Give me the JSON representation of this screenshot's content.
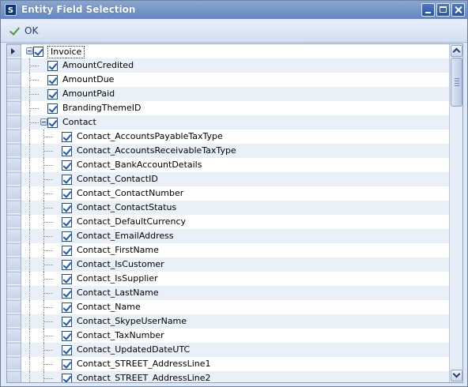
{
  "window": {
    "title": "Entity Field Selection",
    "icon": "app-logo-icon",
    "controls": [
      "minimize-icon",
      "maximize-icon",
      "close-icon"
    ]
  },
  "toolbar": {
    "ok_label": "OK",
    "ok_icon": "checkmark-icon"
  },
  "tree": {
    "root": {
      "label": "Invoice",
      "checked": true,
      "expanded": true
    },
    "top_fields": [
      "AmountCredited",
      "AmountDue",
      "AmountPaid",
      "BrandingThemeID"
    ],
    "contact": {
      "label": "Contact",
      "checked": true,
      "expanded": true
    },
    "contact_fields": [
      "Contact_AccountsPayableTaxType",
      "Contact_AccountsReceivableTaxType",
      "Contact_BankAccountDetails",
      "Contact_ContactID",
      "Contact_ContactNumber",
      "Contact_ContactStatus",
      "Contact_DefaultCurrency",
      "Contact_EmailAddress",
      "Contact_FirstName",
      "Contact_IsCustomer",
      "Contact_IsSupplier",
      "Contact_LastName",
      "Contact_Name",
      "Contact_SkypeUserName",
      "Contact_TaxNumber",
      "Contact_UpdatedDateUTC",
      "Contact_STREET_AddressLine1",
      "Contact_STREET_AddressLine2"
    ]
  },
  "colors": {
    "title_bar": "#6487c0",
    "alt_row": "#eaf0f8",
    "checkbox": "#1a56b6"
  }
}
